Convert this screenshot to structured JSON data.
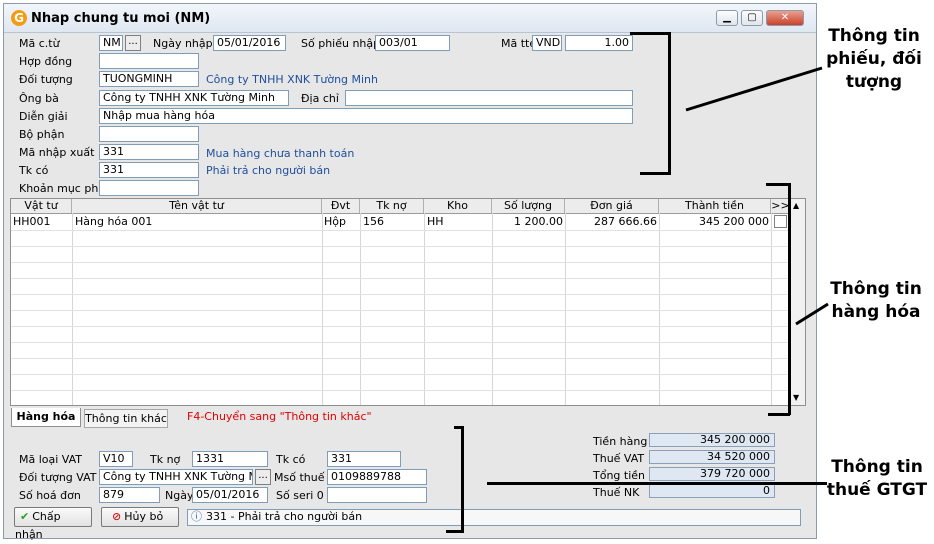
{
  "window": {
    "title": "Nhap chung tu moi (NM)",
    "logo": "G"
  },
  "header": {
    "ma_ct_label": "Mã c.từ",
    "ma_ct_value": "NM",
    "browse": "...",
    "ngay_nhap_label": "Ngày nhập",
    "ngay_nhap_value": "05/01/2016",
    "so_phieu_label": "Số phiếu nhập",
    "so_phieu_value": "003/01",
    "ma_tte_label": "Mã tte",
    "ma_tte_value": "VND",
    "ty_gia_value": "1.00",
    "hop_dong_label": "Hợp đồng",
    "hop_dong_value": "",
    "doi_tuong_label": "Đối tượng",
    "doi_tuong_value": "TUONGMINH",
    "doi_tuong_name": "Công ty TNHH XNK Tường Minh",
    "ong_ba_label": "Ông bà",
    "ong_ba_value": "Công ty TNHH XNK Tường Minh",
    "dia_chi_label": "Địa chỉ",
    "dia_chi_value": "",
    "dien_giai_label": "Diễn giải",
    "dien_giai_value": "Nhập mua hàng hóa",
    "bo_phan_label": "Bộ phận",
    "bo_phan_value": "",
    "ma_nx_label": "Mã nhập xuất",
    "ma_nx_value": "331",
    "ma_nx_desc": "Mua hàng chưa thanh toán",
    "tk_co_label": "Tk có",
    "tk_co_value": "331",
    "tk_co_desc": "Phải trả cho người bán",
    "khoan_muc_label": "Khoản mục phí",
    "khoan_muc_value": ""
  },
  "grid": {
    "columns": [
      "Vật tư",
      "Tên vật tư",
      "Đvt",
      "Tk nợ",
      "Kho",
      "Số lượng",
      "Đơn giá",
      "Thành tiền",
      ">>"
    ],
    "rows": [
      {
        "vat_tu": "HH001",
        "ten": "Hàng hóa 001",
        "dvt": "Hộp",
        "tk_no": "156",
        "kho": "HH",
        "so_luong": "1 200.00",
        "don_gia": "287 666.66",
        "thanh_tien": "345 200 000"
      }
    ]
  },
  "tabs": {
    "hang_hoa": "Hàng hóa",
    "thong_tin_khac": "Thông tin khác",
    "hint": "F4-Chuyển sang \"Thông tin khác\""
  },
  "vat": {
    "ma_loai_label": "Mã loại VAT",
    "ma_loai_value": "V10",
    "tk_no_label": "Tk nợ",
    "tk_no_value": "1331",
    "tk_co_label": "Tk có",
    "tk_co_value": "331",
    "doi_tuong_label": "Đối tượng VAT",
    "doi_tuong_value": "Công ty TNHH XNK Tường Minh",
    "mso_thue_label": "Msố thuế",
    "mso_thue_value": "0109889788",
    "so_hd_label": "Số hoá đơn",
    "so_hd_value": "879",
    "ngay_label": "Ngày",
    "ngay_value": "05/01/2016",
    "so_seri_label": "Số seri 0",
    "so_seri_value": ""
  },
  "totals": {
    "tien_hang_label": "Tiền hàng",
    "tien_hang_value": "345 200 000",
    "thue_vat_label": "Thuế VAT",
    "thue_vat_value": "34 520 000",
    "tong_tien_label": "Tổng tiền",
    "tong_tien_value": "379 720 000",
    "thue_nk_label": "Thuế NK",
    "thue_nk_value": "0"
  },
  "buttons": {
    "accept": "Chấp nhận",
    "cancel": "Hủy bỏ"
  },
  "status": {
    "text": "331 - Phải trả cho người bán"
  },
  "annotations": {
    "a1": [
      "Thông tin",
      "phiếu, đối",
      "tượng"
    ],
    "a2": [
      "Thông tin",
      "hàng hóa"
    ],
    "a3": [
      "Thông tin",
      "thuế GTGT"
    ]
  }
}
